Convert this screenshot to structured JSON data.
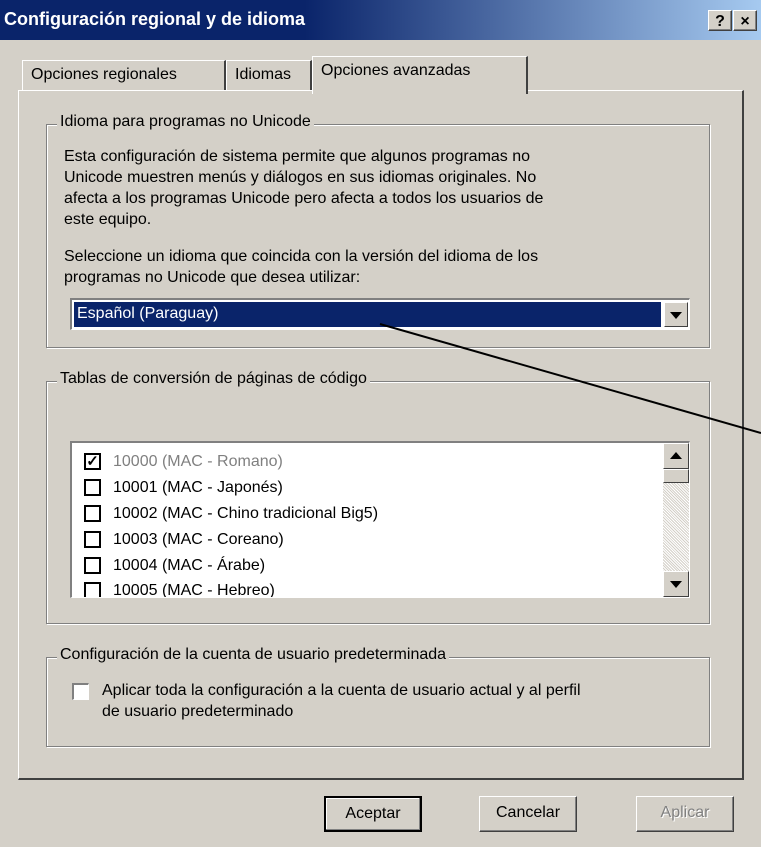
{
  "window": {
    "title": "Configuración regional y de idioma",
    "help_glyph": "?",
    "close_glyph": "×"
  },
  "tabs": [
    {
      "label": "Opciones regionales",
      "active": false
    },
    {
      "label": "Idiomas",
      "active": false
    },
    {
      "label": "Opciones avanzadas",
      "active": true
    }
  ],
  "group_unicode": {
    "legend": "Idioma para programas no Unicode",
    "desc_lines": [
      "Esta configuración de sistema permite que algunos programas no",
      "Unicode muestren menús y diálogos en sus idiomas originales. No",
      "afecta a los programas Unicode pero afecta a todos los usuarios de",
      "este equipo."
    ],
    "select_lines": [
      "Seleccione un idioma que coincida con la versión del idioma de los",
      "programas no Unicode que desea utilizar:"
    ],
    "combo_value": "Español (Paraguay)"
  },
  "group_codepages": {
    "legend": "Tablas de conversión de páginas de código",
    "items": [
      {
        "label": "10000 (MAC - Romano)",
        "checked": true,
        "disabled": true
      },
      {
        "label": "10001 (MAC - Japonés)",
        "checked": false,
        "disabled": false
      },
      {
        "label": "10002 (MAC - Chino tradicional Big5)",
        "checked": false,
        "disabled": false
      },
      {
        "label": "10003 (MAC - Coreano)",
        "checked": false,
        "disabled": false
      },
      {
        "label": "10004 (MAC - Árabe)",
        "checked": false,
        "disabled": false
      },
      {
        "label": "10005 (MAC - Hebreo)",
        "checked": false,
        "disabled": false
      }
    ]
  },
  "group_account": {
    "legend": "Configuración de la cuenta de usuario predeterminada",
    "checkbox_lines": [
      "Aplicar toda la configuración a la cuenta de usuario actual y al perfil",
      "de usuario predeterminado"
    ],
    "checked": false
  },
  "buttons": {
    "ok": "Aceptar",
    "cancel": "Cancelar",
    "apply": "Aplicar"
  },
  "colors": {
    "title_bar": "#0a246a",
    "selection": "#0a246a",
    "face": "#d4d0c8",
    "disabled_text": "#808080"
  }
}
